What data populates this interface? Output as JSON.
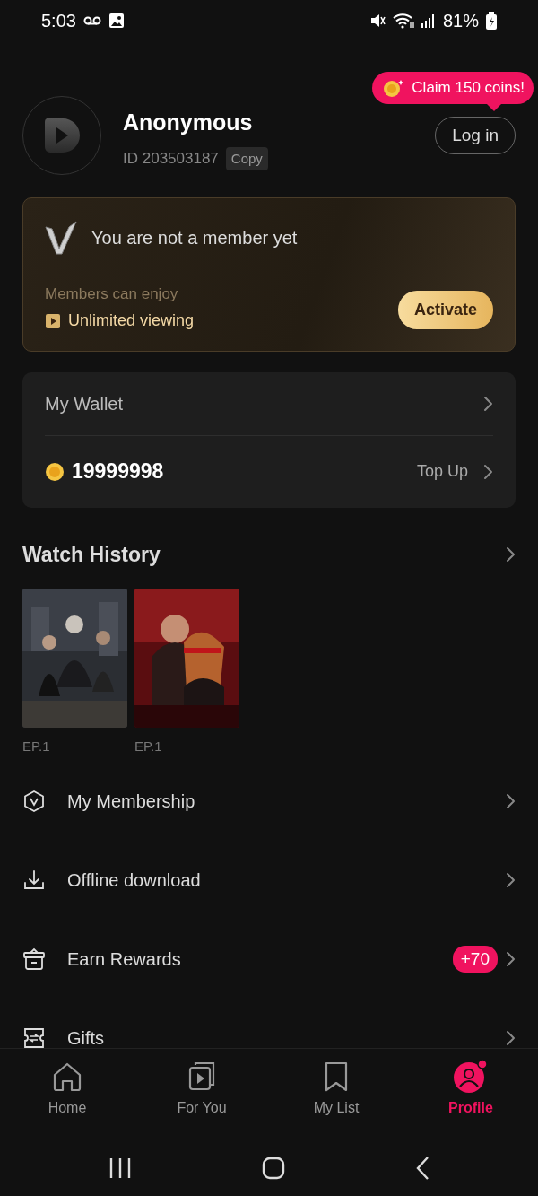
{
  "status_bar": {
    "time": "5:03",
    "battery": "81%"
  },
  "profile": {
    "name": "Anonymous",
    "user_id": "ID 203503187",
    "copy_button": "Copy",
    "promo": "Claim 150 coins!",
    "login_button": "Log in"
  },
  "membership_card": {
    "title": "You are not a member yet",
    "subtitle": "Members can enjoy",
    "benefit": "Unlimited viewing",
    "button": "Activate"
  },
  "wallet": {
    "title": "My Wallet",
    "balance": "19999998",
    "top_up": "Top Up"
  },
  "watch_history": {
    "title": "Watch History",
    "items": [
      {
        "kind": "picture",
        "episode": "EP.1"
      },
      {
        "kind": "picture",
        "episode": "EP.1"
      }
    ]
  },
  "menu": [
    {
      "kind": "membership",
      "label": "My Membership"
    },
    {
      "kind": "download",
      "label": "Offline download"
    },
    {
      "kind": "rewards",
      "label": "Earn Rewards",
      "badge": "+70"
    },
    {
      "kind": "gifts",
      "label": "Gifts"
    }
  ],
  "bottom_nav": [
    {
      "kind": "home",
      "label": "Home",
      "selected": false
    },
    {
      "kind": "foryou",
      "label": "For You",
      "selected": false
    },
    {
      "kind": "mylist",
      "label": "My List",
      "selected": false
    },
    {
      "kind": "profile",
      "label": "Profile",
      "selected": true,
      "dot": true
    }
  ]
}
